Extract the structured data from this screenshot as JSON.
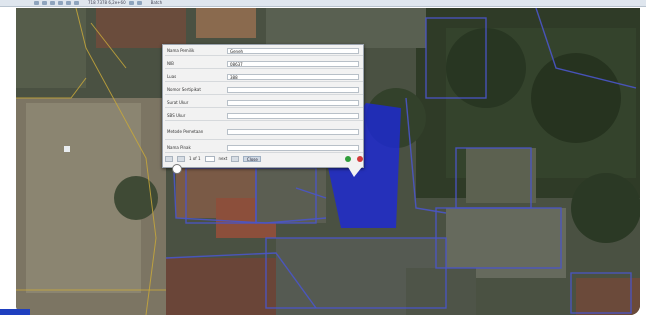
{
  "toolbar": {
    "text_left": "718 7378  6,2e+60",
    "text_right": "Batch"
  },
  "popup": {
    "fields": [
      {
        "label": "Nama Pemilik",
        "value": "Geneh"
      },
      {
        "label": "NIB",
        "value": "08637"
      },
      {
        "label": "Luas",
        "value": "388"
      },
      {
        "label": "Nomor Sertipikat",
        "value": ""
      },
      {
        "label": "Surat Ukur",
        "value": ""
      },
      {
        "label": "SBS Ukur",
        "value": ""
      },
      {
        "label": "Metode Pemetaan",
        "value": ""
      },
      {
        "label": "Nama Pinak",
        "value": ""
      }
    ],
    "pager": {
      "page_label": "1 of 1",
      "next_label": "next",
      "save_label": "Close"
    }
  },
  "colors": {
    "highlight_parcel": "#1c28d8",
    "parcel_outline": "#4a55c8",
    "boundary_line": "#c8a83a"
  }
}
